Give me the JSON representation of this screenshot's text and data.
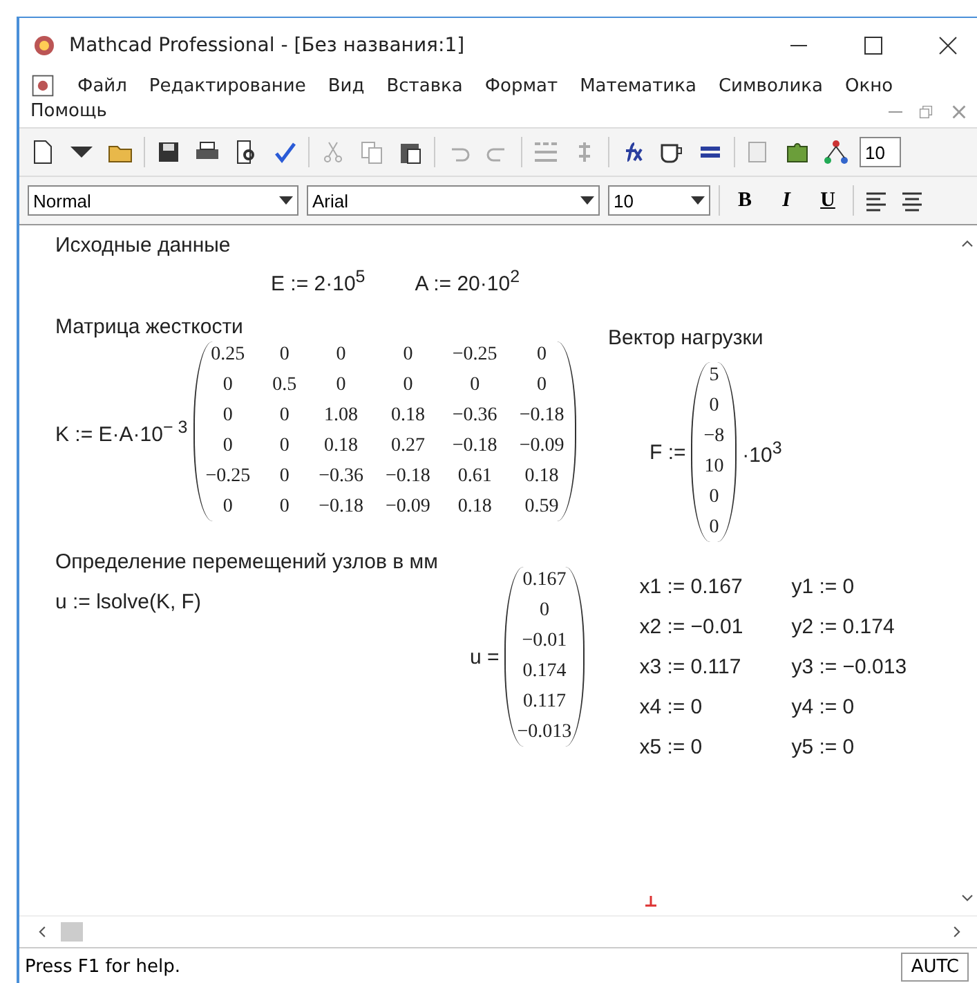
{
  "window": {
    "title": "Mathcad Professional - [Без названия:1]"
  },
  "menu": [
    "Файл",
    "Редактирование",
    "Вид",
    "Вставка",
    "Формат",
    "Математика",
    "Символика",
    "Окно",
    "Помощь"
  ],
  "toolbar": {
    "zoom": "10"
  },
  "format_bar": {
    "style": "Normal",
    "font": "Arial",
    "size": "10",
    "buttons": [
      "B",
      "I",
      "U"
    ]
  },
  "worksheet": {
    "heading_1": "Исходные данные",
    "definitions": [
      "E := 2·10$^{5}$",
      "A := 20·10$^{2}$"
    ],
    "heading_2": "Матрица жесткости",
    "k_label": "K := E·A·10$^{− 3}$",
    "k_matrix": [
      [
        "0.25",
        "0",
        "0",
        "0",
        "−0.25",
        "0"
      ],
      [
        "0",
        "0.5",
        "0",
        "0",
        "0",
        "0"
      ],
      [
        "0",
        "0",
        "1.08",
        "0.18",
        "−0.36",
        "−0.18"
      ],
      [
        "0",
        "0",
        "0.18",
        "0.27",
        "−0.18",
        "−0.09"
      ],
      [
        "−0.25",
        "0",
        "−0.36",
        "−0.18",
        "0.61",
        "0.18"
      ],
      [
        "0",
        "0",
        "−0.18",
        "−0.09",
        "0.18",
        "0.59"
      ]
    ],
    "heading_3": "Вектор нагрузки",
    "f_label": "F :=",
    "f_vector": [
      "5",
      "0",
      "−8",
      "10",
      "0",
      "0"
    ],
    "f_factor": "·10$^{3}$",
    "heading_4": "Определение перемещений узлов в мм",
    "solve": "u := lsolve(K, F)",
    "u_label": "u =",
    "u_vector": [
      "0.167",
      "0",
      "−0.01",
      "0.174",
      "0.117",
      "−0.013"
    ],
    "assignments": [
      [
        "x1 := 0.167",
        "y1 := 0"
      ],
      [
        "x2 := −0.01",
        "y2 := 0.174"
      ],
      [
        "x3 := 0.117",
        "y3 := −0.013"
      ],
      [
        "x4 := 0",
        "y4 := 0"
      ],
      [
        "x5 := 0",
        "y5 := 0"
      ]
    ]
  },
  "status_bar": {
    "help": "Press F1 for help.",
    "mode": "AUTC"
  }
}
